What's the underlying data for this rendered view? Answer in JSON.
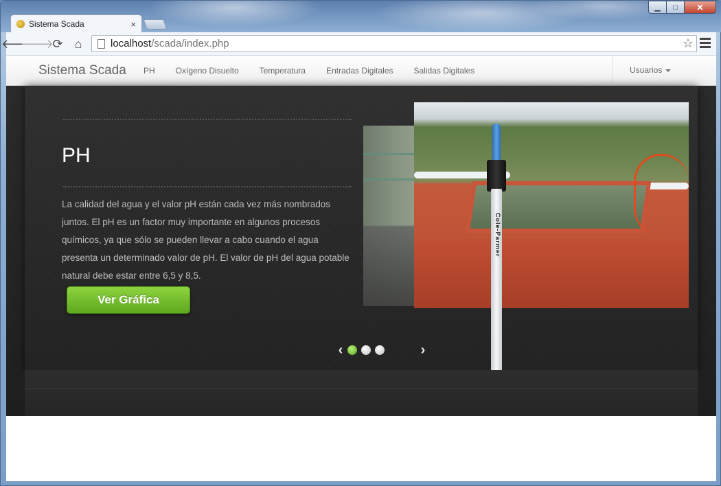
{
  "window": {
    "controls": [
      "minimize",
      "maximize",
      "close"
    ]
  },
  "tab": {
    "title": "Sistema Scada",
    "favicon": "lemon-favicon-icon"
  },
  "toolbar": {
    "url_host": "localhost",
    "url_path": "/scada/index.php"
  },
  "navbar": {
    "brand": "Sistema Scada",
    "links": [
      "PH",
      "Oxígeno Disuelto",
      "Temperatura",
      "Entradas Digitales",
      "Salidas Digitales"
    ],
    "user_menu": "Usuarios"
  },
  "slide": {
    "title": "PH",
    "text": "La calidad del agua y el valor pH están cada vez más nombrados juntos. El pH es un factor muy importante en algunos procesos químicos, ya que sólo se pueden llevar a cabo cuando el agua presenta un determinado valor de pH. El valor de pH del agua potable natural debe estar entre 6,5 y 8,5.",
    "button_label": "Ver Gráfica",
    "probe_label": "Cole-Parmer",
    "pager": {
      "total": 3,
      "active": 1
    }
  },
  "colors": {
    "accent_green": "#6cbb28",
    "slider_bg": "#222222"
  }
}
